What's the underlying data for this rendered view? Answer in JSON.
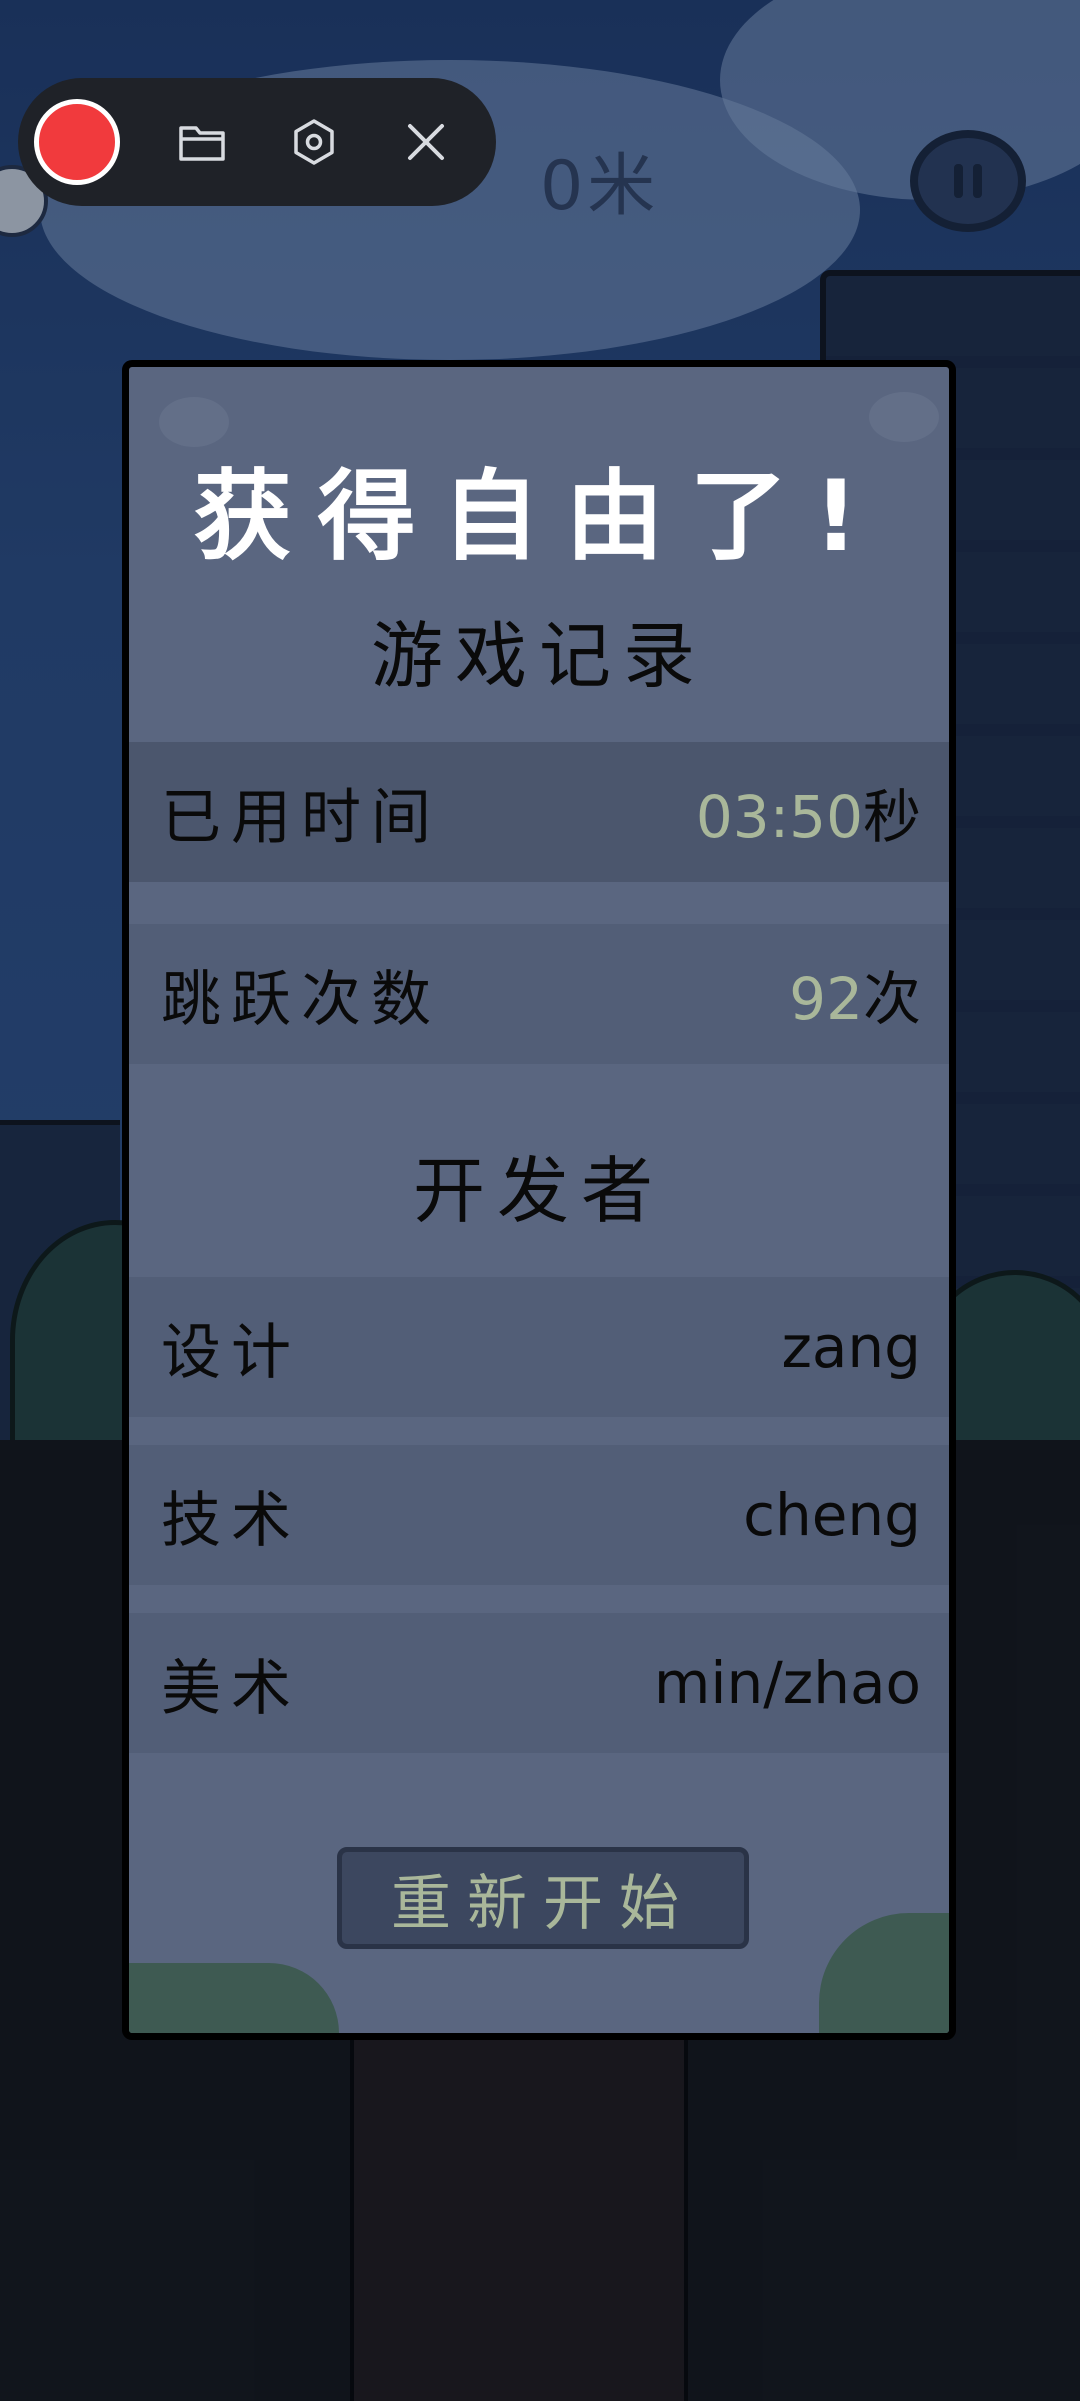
{
  "hud": {
    "distance": "0米"
  },
  "recorder": {
    "icons": [
      "record-dot",
      "folder-icon",
      "settings-icon",
      "close-icon"
    ]
  },
  "panel": {
    "title": "获得自由了!",
    "record_header": "游戏记录",
    "records": [
      {
        "label": "已用时间",
        "value": "03:50",
        "unit": "秒"
      },
      {
        "label": "跳跃次数",
        "value": "92",
        "unit": "次"
      }
    ],
    "developer_header": "开发者",
    "developers": [
      {
        "role": "设计",
        "name": "zang"
      },
      {
        "role": "技术",
        "name": "cheng"
      },
      {
        "role": "美术",
        "name": "min/zhao"
      }
    ],
    "restart_label": "重新开始"
  },
  "colors": {
    "panel_bg": "#5a6680",
    "number_accent": "#a9b79a",
    "record_red": "#f13a3d"
  }
}
